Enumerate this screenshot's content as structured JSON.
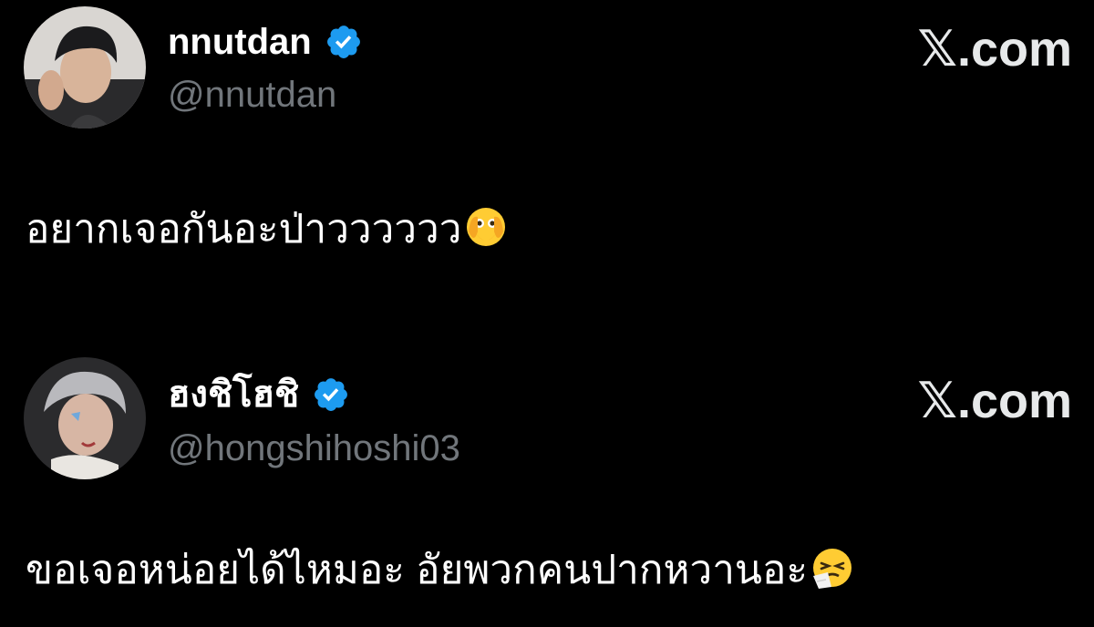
{
  "tweets": [
    {
      "display_name": "nnutdan",
      "handle": "@nnutdan",
      "brand": "𝕏.com",
      "text": "อยากเจอกันอะป่าวววววว",
      "emoji": "face-with-open-eyes-and-hand-over-mouth",
      "verified": true
    },
    {
      "display_name": "ฮงชิโฮชิ",
      "handle": "@hongshihoshi03",
      "brand": "𝕏.com",
      "text": "ขอเจอหน่อยได้ไหมอะ อัยพวกคนปากหวานอะ",
      "emoji": "sneezing-face",
      "verified": true
    }
  ],
  "colors": {
    "background": "#000000",
    "text": "#ffffff",
    "handle": "#71767b",
    "verified": "#1d9bf0"
  }
}
